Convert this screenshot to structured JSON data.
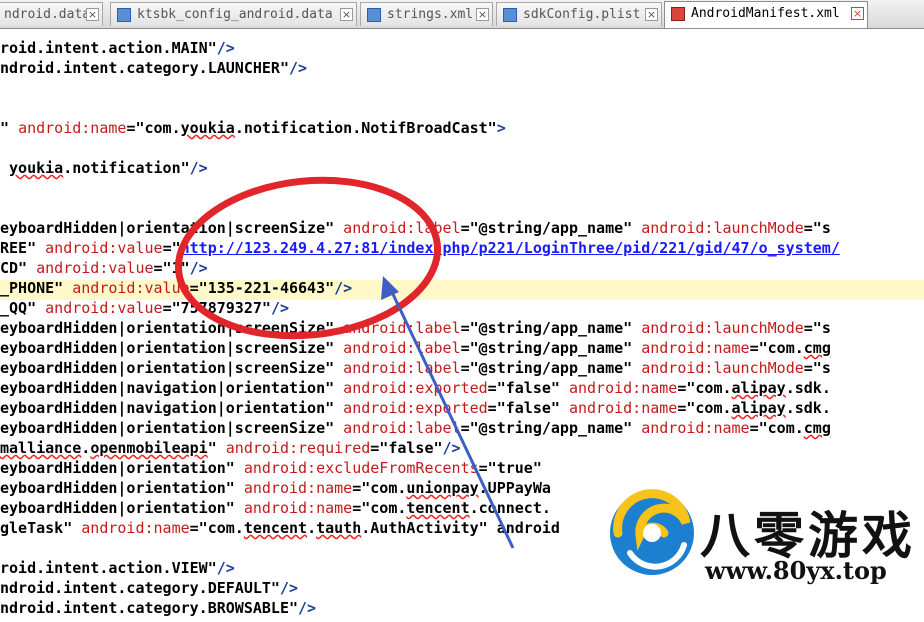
{
  "tabs": [
    {
      "label": "ndroid.data",
      "active": false,
      "icon": "file-icon"
    },
    {
      "label": "ktsbk_config_android.data",
      "active": false,
      "icon": "file-icon"
    },
    {
      "label": "strings.xml",
      "active": false,
      "icon": "file-icon"
    },
    {
      "label": "sdkConfig.plist",
      "active": false,
      "icon": "file-icon"
    },
    {
      "label": "AndroidManifest.xml",
      "active": true,
      "icon": "file-icon-red"
    }
  ],
  "lines": [
    "roid.intent.action.MAIN\"/>",
    "ndroid.intent.category.LAUNCHER\"/>",
    "",
    "",
    "\" android:name=\"com.youkia.notification.NotifBroadCast\">",
    "",
    " youkia.notification\"/>",
    "",
    "",
    "eyboardHidden|orientation|screenSize\" android:label=\"@string/app_name\" android:launchMode=\"s",
    "REE\" android:value=\"http://123.249.4.27:81/index.php/p221/LoginThree/pid/221/gid/47/o_system/",
    "CD\" android:value=\"1\"/>",
    "_PHONE\" android:value=\"135-221-46643\"/>",
    "_QQ\" android:value=\"757879327\"/>",
    "eyboardHidden|orientation|screenSize\" android:label=\"@string/app_name\" android:launchMode=\"s",
    "eyboardHidden|orientation|screenSize\" android:label=\"@string/app_name\" android:name=\"com.cmg",
    "eyboardHidden|orientation|screenSize\" android:label=\"@string/app_name\" android:launchMode=\"s",
    "eyboardHidden|navigation|orientation\" android:exported=\"false\" android:name=\"com.alipay.sdk.",
    "eyboardHidden|navigation|orientation\" android:exported=\"false\" android:name=\"com.alipay.sdk.",
    "eyboardHidden|orientation|screenSize\" android:label=\"@string/app_name\" android:name=\"com.cmg",
    "malliance.openmobileapi\" android:required=\"false\"/>",
    "eyboardHidden|orientation\" android:excludeFromRecents=\"true\"",
    "eyboardHidden|orientation\" android:name=\"com.unionpay.UPPayWa",
    "eyboardHidden|orientation\" android:name=\"com.tencent.connect.",
    "gleTask\" android:name=\"com.tencent.tauth.AuthActivity\" android",
    "",
    "roid.intent.action.VIEW\"/>",
    "ndroid.intent.category.DEFAULT\"/>",
    "ndroid.intent.category.BROWSABLE\"/>"
  ],
  "logo": {
    "cn_text": "八零游戏",
    "url_text": "www.80yx.top"
  },
  "colors": {
    "annotation": "#e0262a",
    "arrow": "#3d5fc4",
    "attribute": "#c41a1a",
    "value": "#7a1fa2",
    "link": "#1a1aff"
  }
}
